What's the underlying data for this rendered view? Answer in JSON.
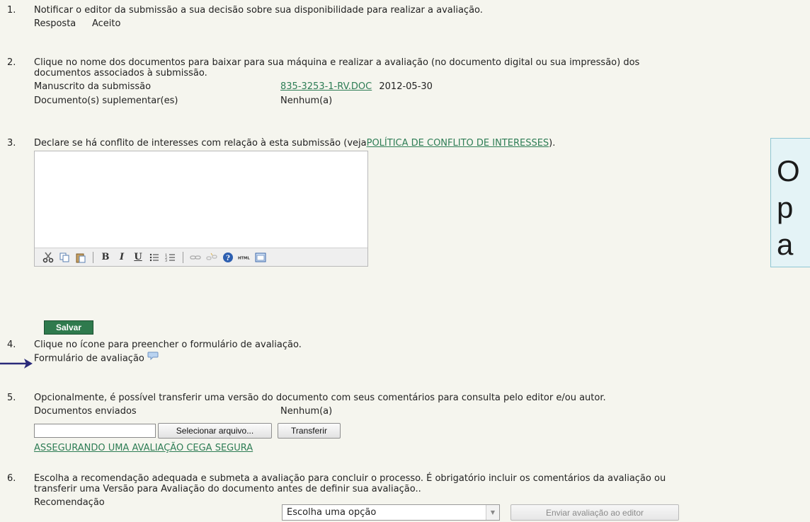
{
  "steps": [
    {
      "num": "1.",
      "text": "Notificar o editor da submissão a sua decisão sobre sua disponibilidade para realizar a avaliação.",
      "response_label": "Resposta",
      "response_value": "Aceito"
    },
    {
      "num": "2.",
      "text_line1": "Clique no nome dos documentos para baixar para sua máquina e realizar a avaliação (no documento digital ou sua impressão) dos",
      "text_line2": "documentos associados à submissão.",
      "manuscript_label": "Manuscrito da submissão",
      "manuscript_file": "835-3253-1-RV.DOC",
      "manuscript_date": "2012-05-30",
      "supplementary_label": "Documento(s) suplementar(es)",
      "supplementary_value": "Nenhum(a)"
    },
    {
      "num": "3.",
      "text": "Declare se há conflito de interesses com relação à esta submissão (veja",
      "policy_link": "POLÍTICA DE CONFLITO DE INTERESSES",
      "text_end": ").",
      "save_label": "Salvar"
    },
    {
      "num": "4.",
      "text": "Clique no ícone para preencher o formulário de avaliação.",
      "form_label": "Formulário de avaliação"
    },
    {
      "num": "5.",
      "text": "Opcionalmente, é possível transferir uma versão do documento com seus comentários para consulta pelo editor e/ou autor.",
      "sent_label": "Documentos enviados",
      "sent_value": "Nenhum(a)",
      "select_file_label": "Selecionar arquivo...",
      "transfer_label": "Transferir",
      "blind_link": "ASSEGURANDO UMA AVALIAÇÃO CEGA SEGURA"
    },
    {
      "num": "6.",
      "text_line1": "Escolha a recomendação adequada e submeta a avaliação para concluir o processo. É obrigatório incluir os comentários da avaliação ou",
      "text_line2": "transferir uma Versão para Avaliação do documento antes de definir sua avaliação..",
      "recommendation_label": "Recomendação",
      "recommendation_value": "Escolha uma opção",
      "send_label": "Enviar avaliação ao editor"
    }
  ],
  "toolbar_icons": [
    "cut-icon",
    "copy-icon",
    "paste-icon",
    "bold-icon",
    "italic-icon",
    "underline-icon",
    "bullet-list-icon",
    "numbered-list-icon",
    "link-icon",
    "unlink-icon",
    "help-icon",
    "html-icon",
    "fullscreen-icon"
  ],
  "callout_lines": [
    "O",
    "p",
    "a"
  ],
  "colors": {
    "link": "#2e7d55",
    "save_button": "#2f7a4d",
    "pointer_arrow": "#2a2a7a",
    "callout_bg": "#e4f3f6"
  }
}
